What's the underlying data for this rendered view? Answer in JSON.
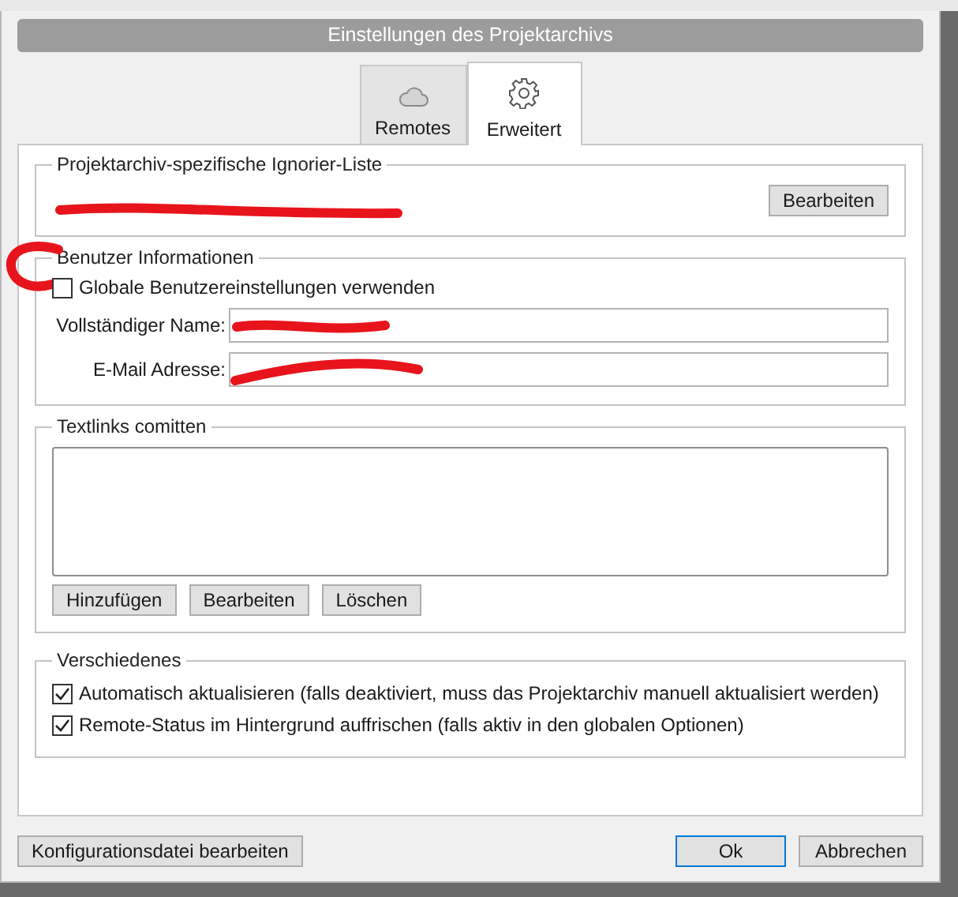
{
  "window": {
    "title": "Einstellungen des Projektarchivs"
  },
  "tabs": [
    {
      "label": "Remotes",
      "selected": false
    },
    {
      "label": "Erweitert",
      "selected": true
    }
  ],
  "ignore_list": {
    "title": "Projektarchiv-spezifische Ignorier-Liste",
    "button": "Bearbeiten"
  },
  "user_info": {
    "title": "Benutzer Informationen",
    "use_global": {
      "label": "Globale Benutzereinstellungen verwenden",
      "checked": false
    },
    "fields": [
      {
        "label": "Vollständiger Name:"
      },
      {
        "label": "E-Mail Adresse:"
      }
    ]
  },
  "textlinks": {
    "title": "Textlinks comitten",
    "buttons": [
      "Hinzufügen",
      "Bearbeiten",
      "Löschen"
    ]
  },
  "misc": {
    "title": "Verschiedenes",
    "options": [
      {
        "label": "Automatisch aktualisieren (falls deaktiviert, muss das Projektarchiv manuell aktualisiert werden)",
        "checked": true
      },
      {
        "label": "Remote-Status im Hintergrund auffrischen (falls aktiv in den globalen Optionen)",
        "checked": true
      }
    ]
  },
  "footer": {
    "left_button": "Konfigurationsdatei bearbeiten",
    "ok": "Ok",
    "cancel": "Abbrechen"
  }
}
